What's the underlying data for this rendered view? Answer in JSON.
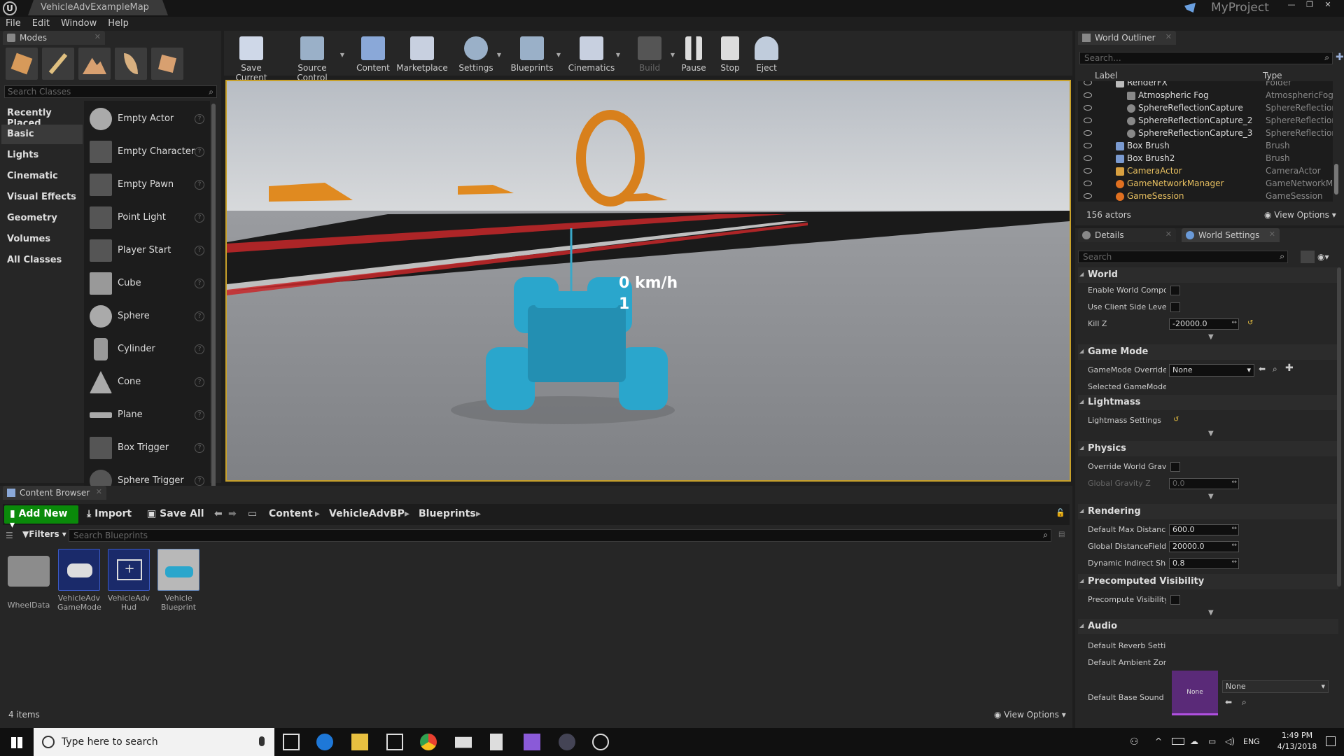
{
  "window": {
    "doc_tab": "VehicleAdvExampleMap",
    "project": "MyProject",
    "logo": "U"
  },
  "menu": [
    "File",
    "Edit",
    "Window",
    "Help"
  ],
  "modes": {
    "tab_label": "Modes",
    "search_placeholder": "Search Classes",
    "categories": [
      "Recently Placed",
      "Basic",
      "Lights",
      "Cinematic",
      "Visual Effects",
      "Geometry",
      "Volumes",
      "All Classes"
    ],
    "active_category": "Basic",
    "classes": [
      "Empty Actor",
      "Empty Character",
      "Empty Pawn",
      "Point Light",
      "Player Start",
      "Cube",
      "Sphere",
      "Cylinder",
      "Cone",
      "Plane",
      "Box Trigger",
      "Sphere Trigger"
    ]
  },
  "toolbar": {
    "buttons": [
      "Save Current",
      "Source Control",
      "Content",
      "Marketplace",
      "Settings",
      "Blueprints",
      "Cinematics",
      "Build",
      "Pause",
      "Stop",
      "Eject"
    ]
  },
  "viewport": {
    "speed": "0 km/h",
    "gear": "1"
  },
  "outliner": {
    "tab_label": "World Outliner",
    "search_placeholder": "Search...",
    "col_label": "Label",
    "col_type": "Type",
    "rows": [
      {
        "name": "RenderFX",
        "type": "Folder"
      },
      {
        "name": "Atmospheric Fog",
        "type": "AtmosphericFog"
      },
      {
        "name": "SphereReflectionCapture",
        "type": "SphereReflectionC"
      },
      {
        "name": "SphereReflectionCapture_2",
        "type": "SphereReflectionC"
      },
      {
        "name": "SphereReflectionCapture_3",
        "type": "SphereReflectionC"
      },
      {
        "name": "Box Brush",
        "type": "Brush"
      },
      {
        "name": "Box Brush2",
        "type": "Brush"
      },
      {
        "name": "CameraActor",
        "type": "CameraActor"
      },
      {
        "name": "GameNetworkManager",
        "type": "GameNetworkMan"
      },
      {
        "name": "GameSession",
        "type": "GameSession"
      }
    ],
    "actor_count": "156 actors",
    "view_options": "View Options"
  },
  "details": {
    "tab_details": "Details",
    "tab_world_settings": "World Settings",
    "search_placeholder": "Search",
    "sections": {
      "world": "World",
      "game_mode": "Game Mode",
      "lightmass": "Lightmass",
      "physics": "Physics",
      "rendering": "Rendering",
      "precomputed_visibility": "Precomputed Visibility",
      "audio": "Audio"
    },
    "props": {
      "enable_world_composition": "Enable World Composi",
      "use_client_side_level": "Use Client Side Level",
      "kill_z": "Kill Z",
      "kill_z_value": "-20000.0",
      "gamemode_override": "GameMode Override",
      "gamemode_value": "None",
      "selected_gamemode": "Selected GameMode",
      "lightmass_settings": "Lightmass Settings",
      "override_world_gravity": "Override World Gravity",
      "global_gravity_z": "Global Gravity Z",
      "global_gravity_value": "0.0",
      "default_max_distance": "Default Max Distance",
      "default_max_distance_value": "600.0",
      "global_distancefield": "Global DistanceField V",
      "global_distancefield_value": "20000.0",
      "dynamic_indirect": "Dynamic Indirect Shac",
      "dynamic_indirect_value": "0.8",
      "precompute_visibility": "Precompute Visibility",
      "default_reverb": "Default Reverb Setting",
      "default_ambient": "Default Ambient Zone",
      "default_base_sound": "Default Base Sound M",
      "sound_thumb": "None",
      "sound_value": "None"
    }
  },
  "content_browser": {
    "tab_label": "Content Browser",
    "add_new": "Add New",
    "import": "Import",
    "save_all": "Save All",
    "breadcrumb": [
      "Content",
      "VehicleAdvBP",
      "Blueprints"
    ],
    "filters": "Filters",
    "search_placeholder": "Search Blueprints",
    "assets": [
      {
        "line1": "WheelData",
        "line2": ""
      },
      {
        "line1": "VehicleAdv",
        "line2": "GameMode"
      },
      {
        "line1": "VehicleAdv",
        "line2": "Hud"
      },
      {
        "line1": "Vehicle",
        "line2": "Blueprint"
      }
    ],
    "item_count": "4 items",
    "view_options": "View Options"
  },
  "taskbar": {
    "search": "Type here to search",
    "lang": "ENG",
    "time": "1:49 PM",
    "date": "4/13/2018"
  }
}
